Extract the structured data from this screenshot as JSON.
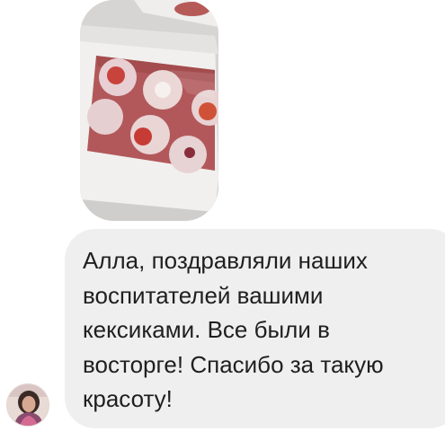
{
  "conversation": {
    "photo_message": {
      "icon": "cupcake-box-photo"
    },
    "text_message": {
      "text": "Алла, поздравляли наших\nвоспитателей вашими\nкексиками. Все были в\nвосторге! Спасибо за такую\nкрасоту!"
    },
    "sender": {
      "avatar_icon": "user-avatar-photo"
    }
  },
  "colors": {
    "bubble_background": "#efefef",
    "message_text": "#1f1f1f",
    "page_background": "#ffffff"
  }
}
